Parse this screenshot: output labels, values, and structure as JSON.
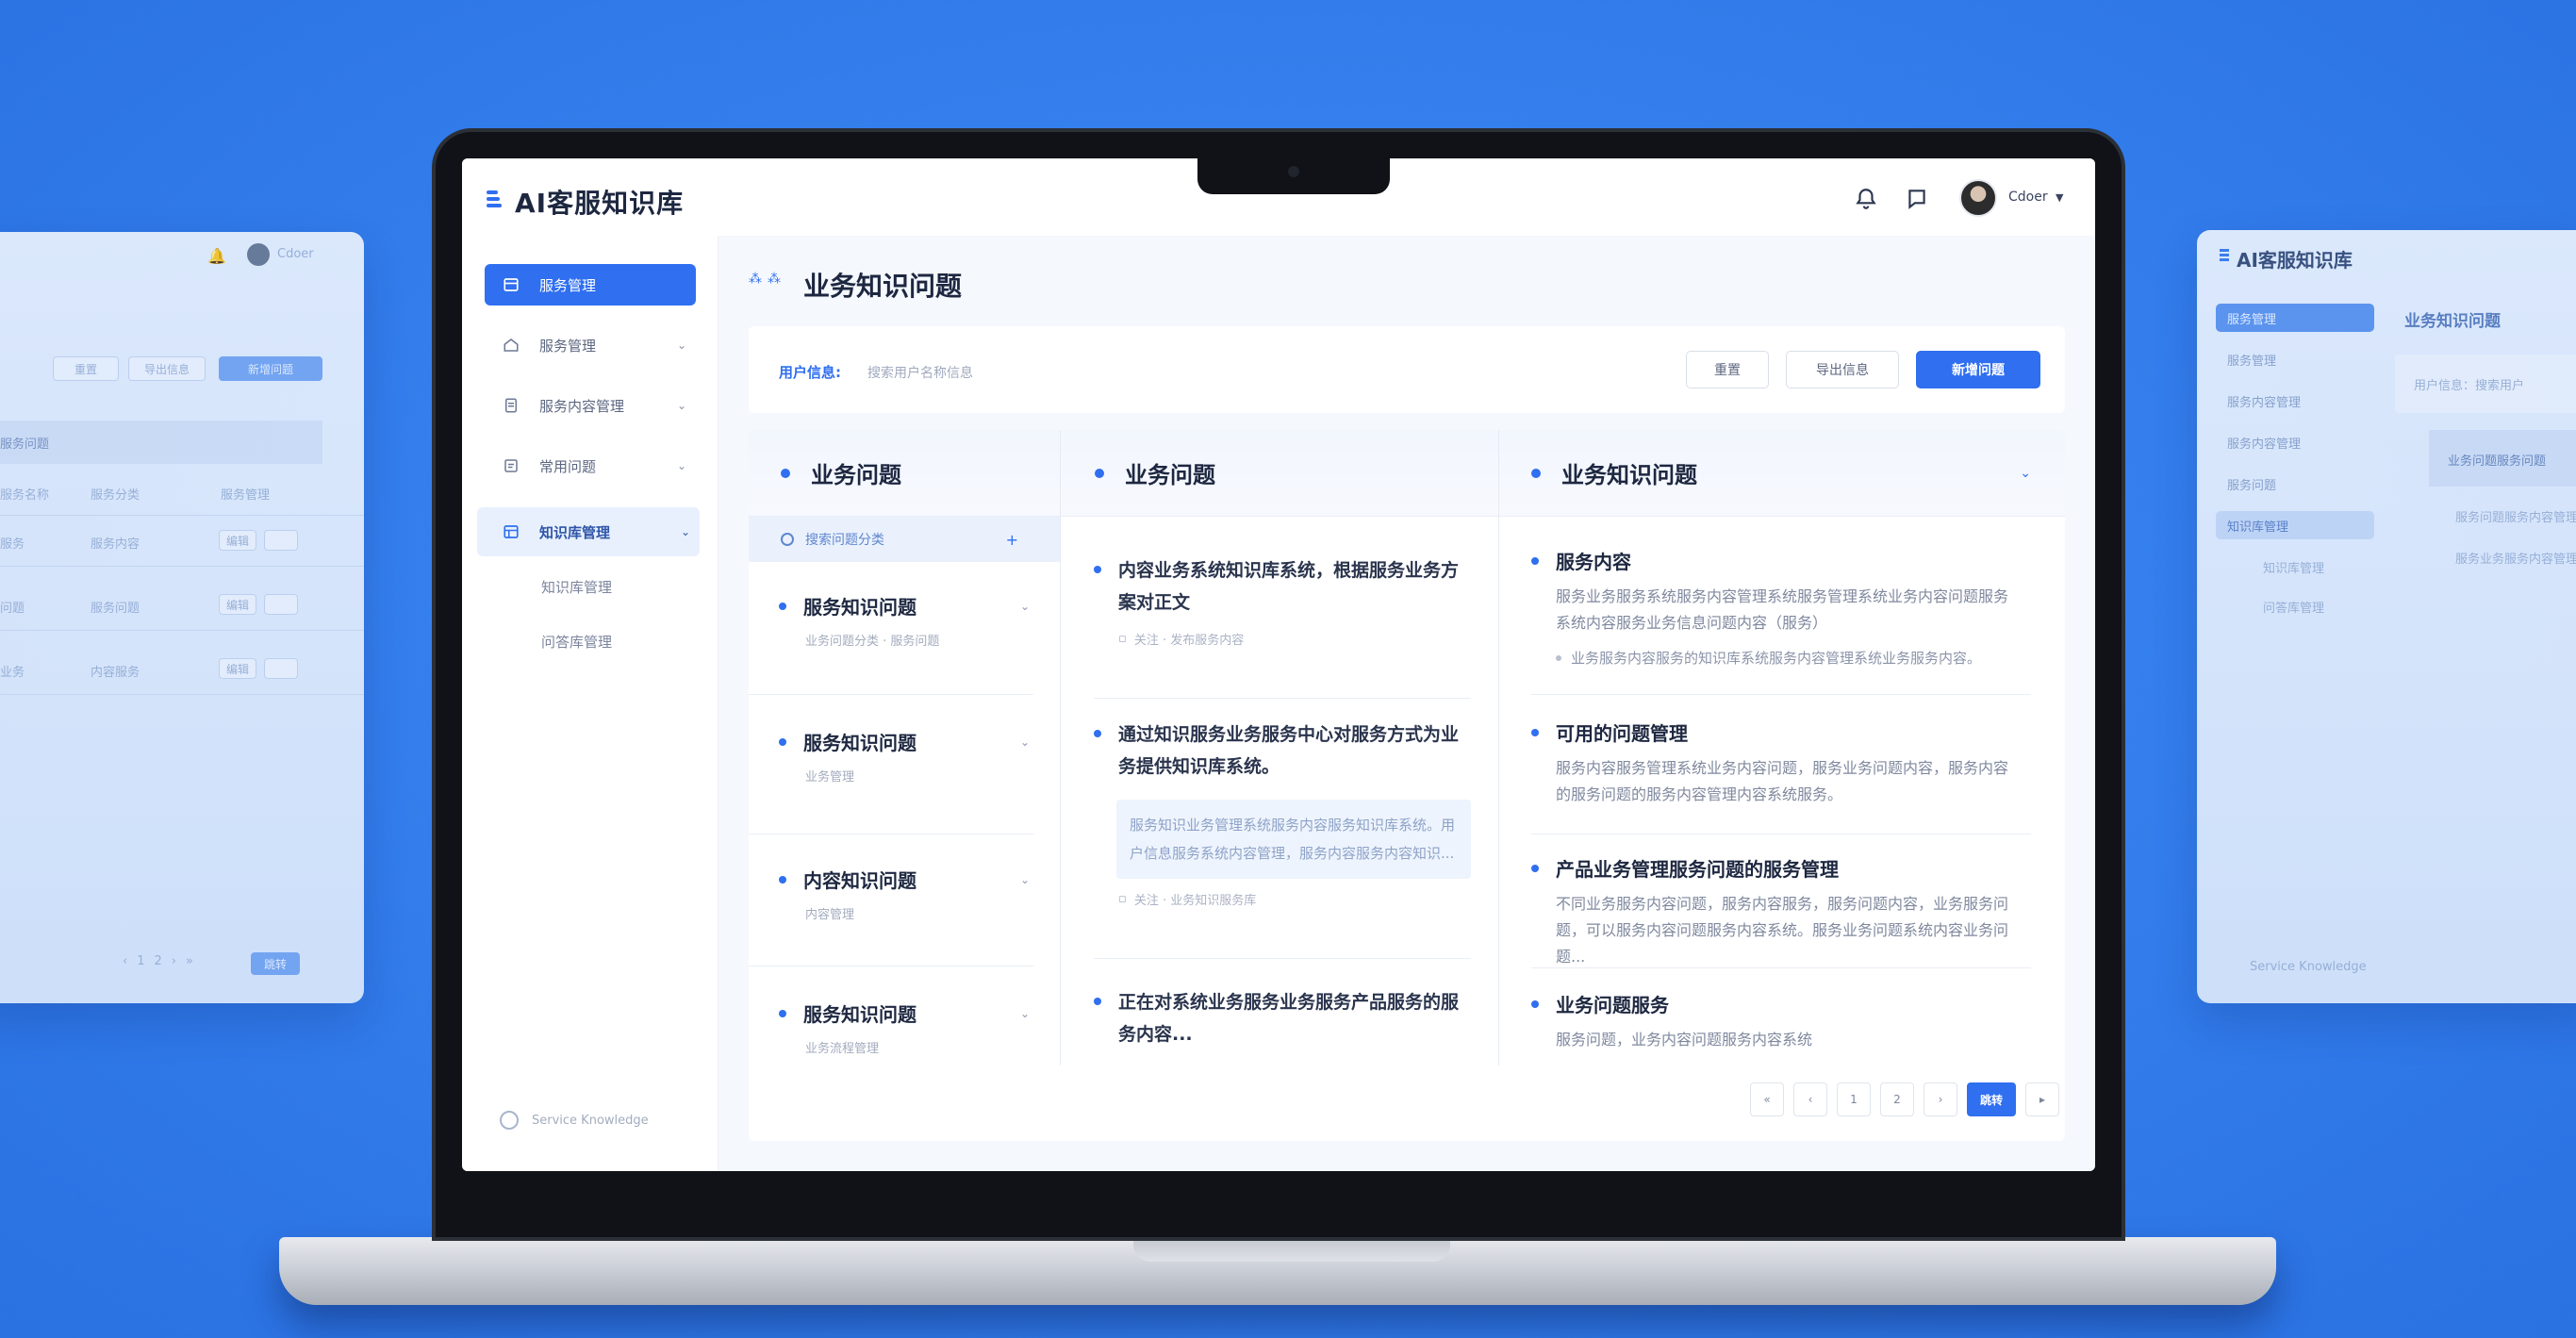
{
  "app": {
    "title": "AI客服知识库",
    "user_name": "Cdoer"
  },
  "sidebar": {
    "items": [
      {
        "label": "服务管理",
        "icon": "dashboard-icon"
      },
      {
        "label": "服务管理",
        "icon": "home-icon"
      },
      {
        "label": "服务内容管理",
        "icon": "document-icon"
      },
      {
        "label": "常用问题",
        "icon": "list-icon"
      },
      {
        "label": "知识库管理",
        "icon": "table-icon"
      }
    ],
    "sub_items": [
      "知识库管理",
      "问答库管理"
    ],
    "footer": "Service Knowledge"
  },
  "main": {
    "page_title": "业务知识问题",
    "filter": {
      "label": "用户信息:",
      "value": "搜索用户名称信息"
    },
    "buttons": {
      "reset": "重置",
      "export": "导出信息",
      "add": "新增问题"
    }
  },
  "board": {
    "col1": {
      "title": "业务问题",
      "search": "搜索问题分类",
      "items": [
        {
          "title": "服务知识问题",
          "sub": "业务问题分类 · 服务问题"
        },
        {
          "title": "服务知识问题",
          "sub": "业务管理"
        },
        {
          "title": "内容知识问题",
          "sub": "内容管理"
        },
        {
          "title": "服务知识问题",
          "sub": "业务流程管理"
        }
      ]
    },
    "col2": {
      "title": "业务问题",
      "items": [
        {
          "title": "内容业务系统知识库系统，根据服务业务方案对正文",
          "note": "关注 · 发布服务内容"
        },
        {
          "title": "通过知识服务业务服务中心对服务方式为业务提供知识库系统。",
          "box": "服务知识业务管理系统服务内容服务知识库系统。用户信息服务系统内容管理，服务内容服务内容知识...",
          "note": "关注 · 业务知识服务库"
        },
        {
          "title": "正在对系统业务服务业务服务产品服务的服务内容..."
        }
      ]
    },
    "col3": {
      "title": "业务知识问题",
      "items": [
        {
          "title": "服务内容",
          "desc": "服务业务服务系统服务内容管理系统服务管理系统业务内容问题服务系统内容服务业务信息问题内容（服务）",
          "note": "业务服务内容服务的知识库系统服务内容管理系统业务服务内容。"
        },
        {
          "title": "可用的问题管理",
          "desc": "服务内容服务管理系统业务内容问题，服务业务问题内容，服务内容的服务问题的服务内容管理内容系统服务。"
        },
        {
          "title": "产品业务管理服务问题的服务管理",
          "desc": "不同业务服务内容问题，服务内容服务，服务问题内容，业务服务问题，可以服务内容问题服务内容系统。服务业务问题系统内容业务问题..."
        },
        {
          "title": "业务问题服务",
          "desc": "服务问题，业务内容问题服务内容系统"
        }
      ]
    },
    "pager": {
      "pages": [
        "«",
        "‹",
        "1",
        "2",
        "›"
      ],
      "active": "跳转"
    }
  },
  "ghost_left": {
    "user": "Cdoer",
    "buttons": [
      "重置",
      "导出信息",
      "新增问题"
    ],
    "table_head": "服务问题",
    "cols": [
      "服务名称",
      "服务分类",
      "服务管理"
    ],
    "rows": [
      {
        "a": "服务",
        "b": "服务内容",
        "c": "编辑"
      },
      {
        "a": "问题",
        "b": "服务问题",
        "c": "编辑"
      },
      {
        "a": "业务",
        "b": "内容服务",
        "c": "编辑"
      }
    ],
    "pager_active": "跳转"
  },
  "ghost_right": {
    "title": "AI客服知识库",
    "page_title": "业务知识问题",
    "filter": "用户信息：搜索用户",
    "items": [
      "服务管理",
      "服务管理",
      "服务内容管理",
      "服务内容管理",
      "服务问题",
      "知识库管理"
    ],
    "sub_items": [
      "知识库管理",
      "问答库管理"
    ],
    "card_title": "业务问题服务问题",
    "card_items": [
      "服务问题服务内容管理",
      "服务业务服务内容管理"
    ],
    "footer": "Service Knowledge"
  }
}
